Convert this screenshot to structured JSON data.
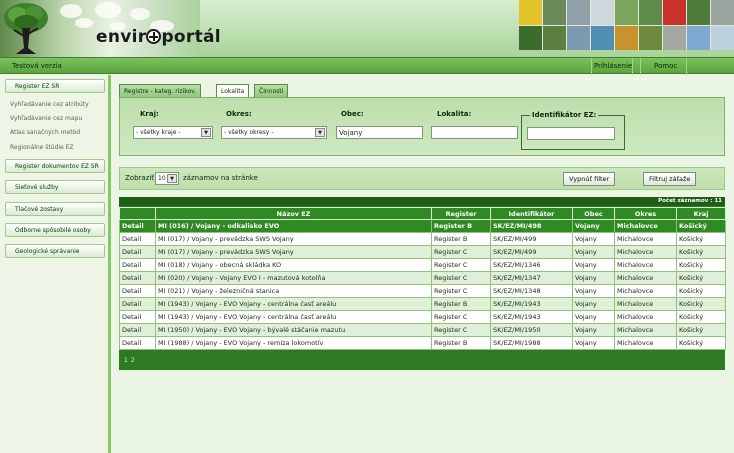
{
  "header": {
    "logo_text_pre": "envir",
    "logo_text_post": "portál"
  },
  "topnav": {
    "environment": "Testová verzia",
    "login": "Prihlásenie",
    "help": "Pomoc"
  },
  "sidebar": {
    "buttons": [
      "Register EZ SR",
      "Register dokumentov EZ SR",
      "Sieťové služby",
      "Tlačové zostavy",
      "Odborne spôsobilé osoby",
      "Geologické správanie"
    ],
    "sub_items": [
      "Vyhľadávanie cez atribúty",
      "Vyhľadávanie cez mapu",
      "Atlas sanačných metód",
      "Regionálne štúdie EZ"
    ]
  },
  "tabs": [
    {
      "label": "Registre - kateg. rizikov.",
      "active": false
    },
    {
      "label": "Lokalita",
      "active": true
    },
    {
      "label": "Činnosti",
      "active": false
    }
  ],
  "filter": {
    "kraj_label": "Kraj:",
    "kraj_value": "- všetky kraje -",
    "okres_label": "Okres:",
    "okres_value": "- všetky okresy -",
    "obec_label": "Obec:",
    "obec_value": "Vojany",
    "lokalita_label": "Lokalita:",
    "lokalita_value": "",
    "ez_label": "Identifikátor EZ:",
    "ez_value": ""
  },
  "paging": {
    "show_label": "Zobraziť",
    "page_size": "10",
    "per_page_label": "záznamov na stránke",
    "filter_off_button": "Vypnúť filter",
    "filter_set_button": "Filtruj záťaže"
  },
  "results": {
    "count_label": "Počet záznamov : 11",
    "columns": [
      "",
      "Názov EZ",
      "Register",
      "Identifikátor",
      "Obec",
      "Okres",
      "Kraj"
    ],
    "rows": [
      [
        "Detail",
        "MI (016) / Vojany - odkalisko EVO",
        "Register B",
        "SK/EZ/MI/498",
        "Vojany",
        "Michalovce",
        "Košický"
      ],
      [
        "Detail",
        "MI (017) / Vojany - prevádzka SWS Vojany",
        "Register B",
        "SK/EZ/MI/499",
        "Vojany",
        "Michalovce",
        "Košický"
      ],
      [
        "Detail",
        "MI (017) / Vojany - prevádzka SWS Vojany",
        "Register C",
        "SK/EZ/MI/499",
        "Vojany",
        "Michalovce",
        "Košický"
      ],
      [
        "Detail",
        "MI (018) / Vojany - obecná skládka KO",
        "Register C",
        "SK/EZ/MI/1346",
        "Vojany",
        "Michalovce",
        "Košický"
      ],
      [
        "Detail",
        "MI (020) / Vojany - Vojany EVO I - mazutová kotolňa",
        "Register C",
        "SK/EZ/MI/1347",
        "Vojany",
        "Michalovce",
        "Košický"
      ],
      [
        "Detail",
        "MI (021) / Vojany - železničná stanica",
        "Register C",
        "SK/EZ/MI/1348",
        "Vojany",
        "Michalovce",
        "Košický"
      ],
      [
        "Detail",
        "MI (1943) / Vojany - EVO Vojany - centrálna časť areálu",
        "Register B",
        "SK/EZ/MI/1943",
        "Vojany",
        "Michalovce",
        "Košický"
      ],
      [
        "Detail",
        "MI (1943) / Vojany - EVO Vojany - centrálna časť areálu",
        "Register C",
        "SK/EZ/MI/1943",
        "Vojany",
        "Michalovce",
        "Košický"
      ],
      [
        "Detail",
        "MI (1950) / Vojany - EVO Vojany - bývalé stáčanie mazutu",
        "Register C",
        "SK/EZ/MI/1950",
        "Vojany",
        "Michalovce",
        "Košický"
      ],
      [
        "Detail",
        "MI (1988) / Vojany - EVO Vojany - remíza lokomotív",
        "Register B",
        "SK/EZ/MI/1988",
        "Vojany",
        "Michalovce",
        "Košický"
      ]
    ],
    "pages": [
      "1",
      "2"
    ]
  },
  "colors": {
    "brand_green": "#2f8a23",
    "nav_green": "#6bb44f",
    "row_alt": "#dff0d6"
  }
}
